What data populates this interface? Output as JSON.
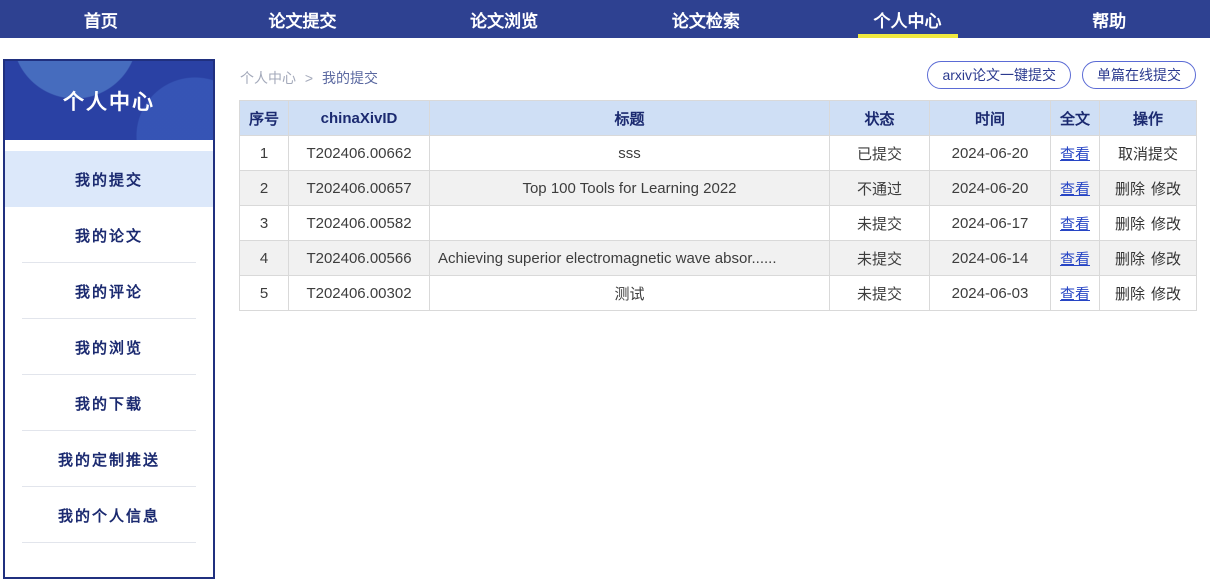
{
  "nav": {
    "items": [
      {
        "label": "首页",
        "active": false
      },
      {
        "label": "论文提交",
        "active": false
      },
      {
        "label": "论文浏览",
        "active": false
      },
      {
        "label": "论文检索",
        "active": false
      },
      {
        "label": "个人中心",
        "active": true
      },
      {
        "label": "帮助",
        "active": false
      }
    ]
  },
  "sidebar": {
    "title": "个人中心",
    "items": [
      {
        "label": "我的提交",
        "active": true
      },
      {
        "label": "我的论文",
        "active": false
      },
      {
        "label": "我的评论",
        "active": false
      },
      {
        "label": "我的浏览",
        "active": false
      },
      {
        "label": "我的下载",
        "active": false
      },
      {
        "label": "我的定制推送",
        "active": false
      },
      {
        "label": "我的个人信息",
        "active": false
      }
    ]
  },
  "breadcrumb": {
    "parent": "个人中心",
    "separator": ">",
    "current": "我的提交"
  },
  "toolbar": {
    "arxiv_submit_label": "arxiv论文一键提交",
    "single_submit_label": "单篇在线提交"
  },
  "table": {
    "headers": {
      "no": "序号",
      "id": "chinaXivID",
      "title": "标题",
      "status": "状态",
      "date": "时间",
      "fulltext": "全文",
      "action": "操作"
    },
    "rows": [
      {
        "no": "1",
        "id": "T202406.00662",
        "title": "sss",
        "status": "已提交",
        "date": "2024-06-20",
        "view": "查看",
        "action1": "取消提交",
        "action2": ""
      },
      {
        "no": "2",
        "id": "T202406.00657",
        "title": "Top 100 Tools for Learning 2022",
        "status": "不通过",
        "date": "2024-06-20",
        "view": "查看",
        "action1": "删除",
        "action2": "修改"
      },
      {
        "no": "3",
        "id": "T202406.00582",
        "title": "",
        "status": "未提交",
        "date": "2024-06-17",
        "view": "查看",
        "action1": "删除",
        "action2": "修改"
      },
      {
        "no": "4",
        "id": "T202406.00566",
        "title": "Achieving superior electromagnetic wave absor......",
        "status": "未提交",
        "date": "2024-06-14",
        "view": "查看",
        "action1": "删除",
        "action2": "修改"
      },
      {
        "no": "5",
        "id": "T202406.00302",
        "title": "测试",
        "status": "未提交",
        "date": "2024-06-03",
        "view": "查看",
        "action1": "删除",
        "action2": "修改"
      }
    ]
  },
  "colors": {
    "nav_bg": "#2e4191",
    "nav_text": "#ffffff",
    "active_underline": "#f0e940",
    "sidebar_border": "#20307f",
    "sidebar_header_bg": "#2a41a4",
    "sidebar_active_bg": "#dce8fa",
    "sidebar_text": "#1b2a70",
    "table_header_bg": "#cfdff5",
    "row_alt_bg": "#f1f1f1",
    "link_blue": "#2745c5",
    "button_border": "#5b6bd5",
    "button_text": "#2b3a8f"
  }
}
